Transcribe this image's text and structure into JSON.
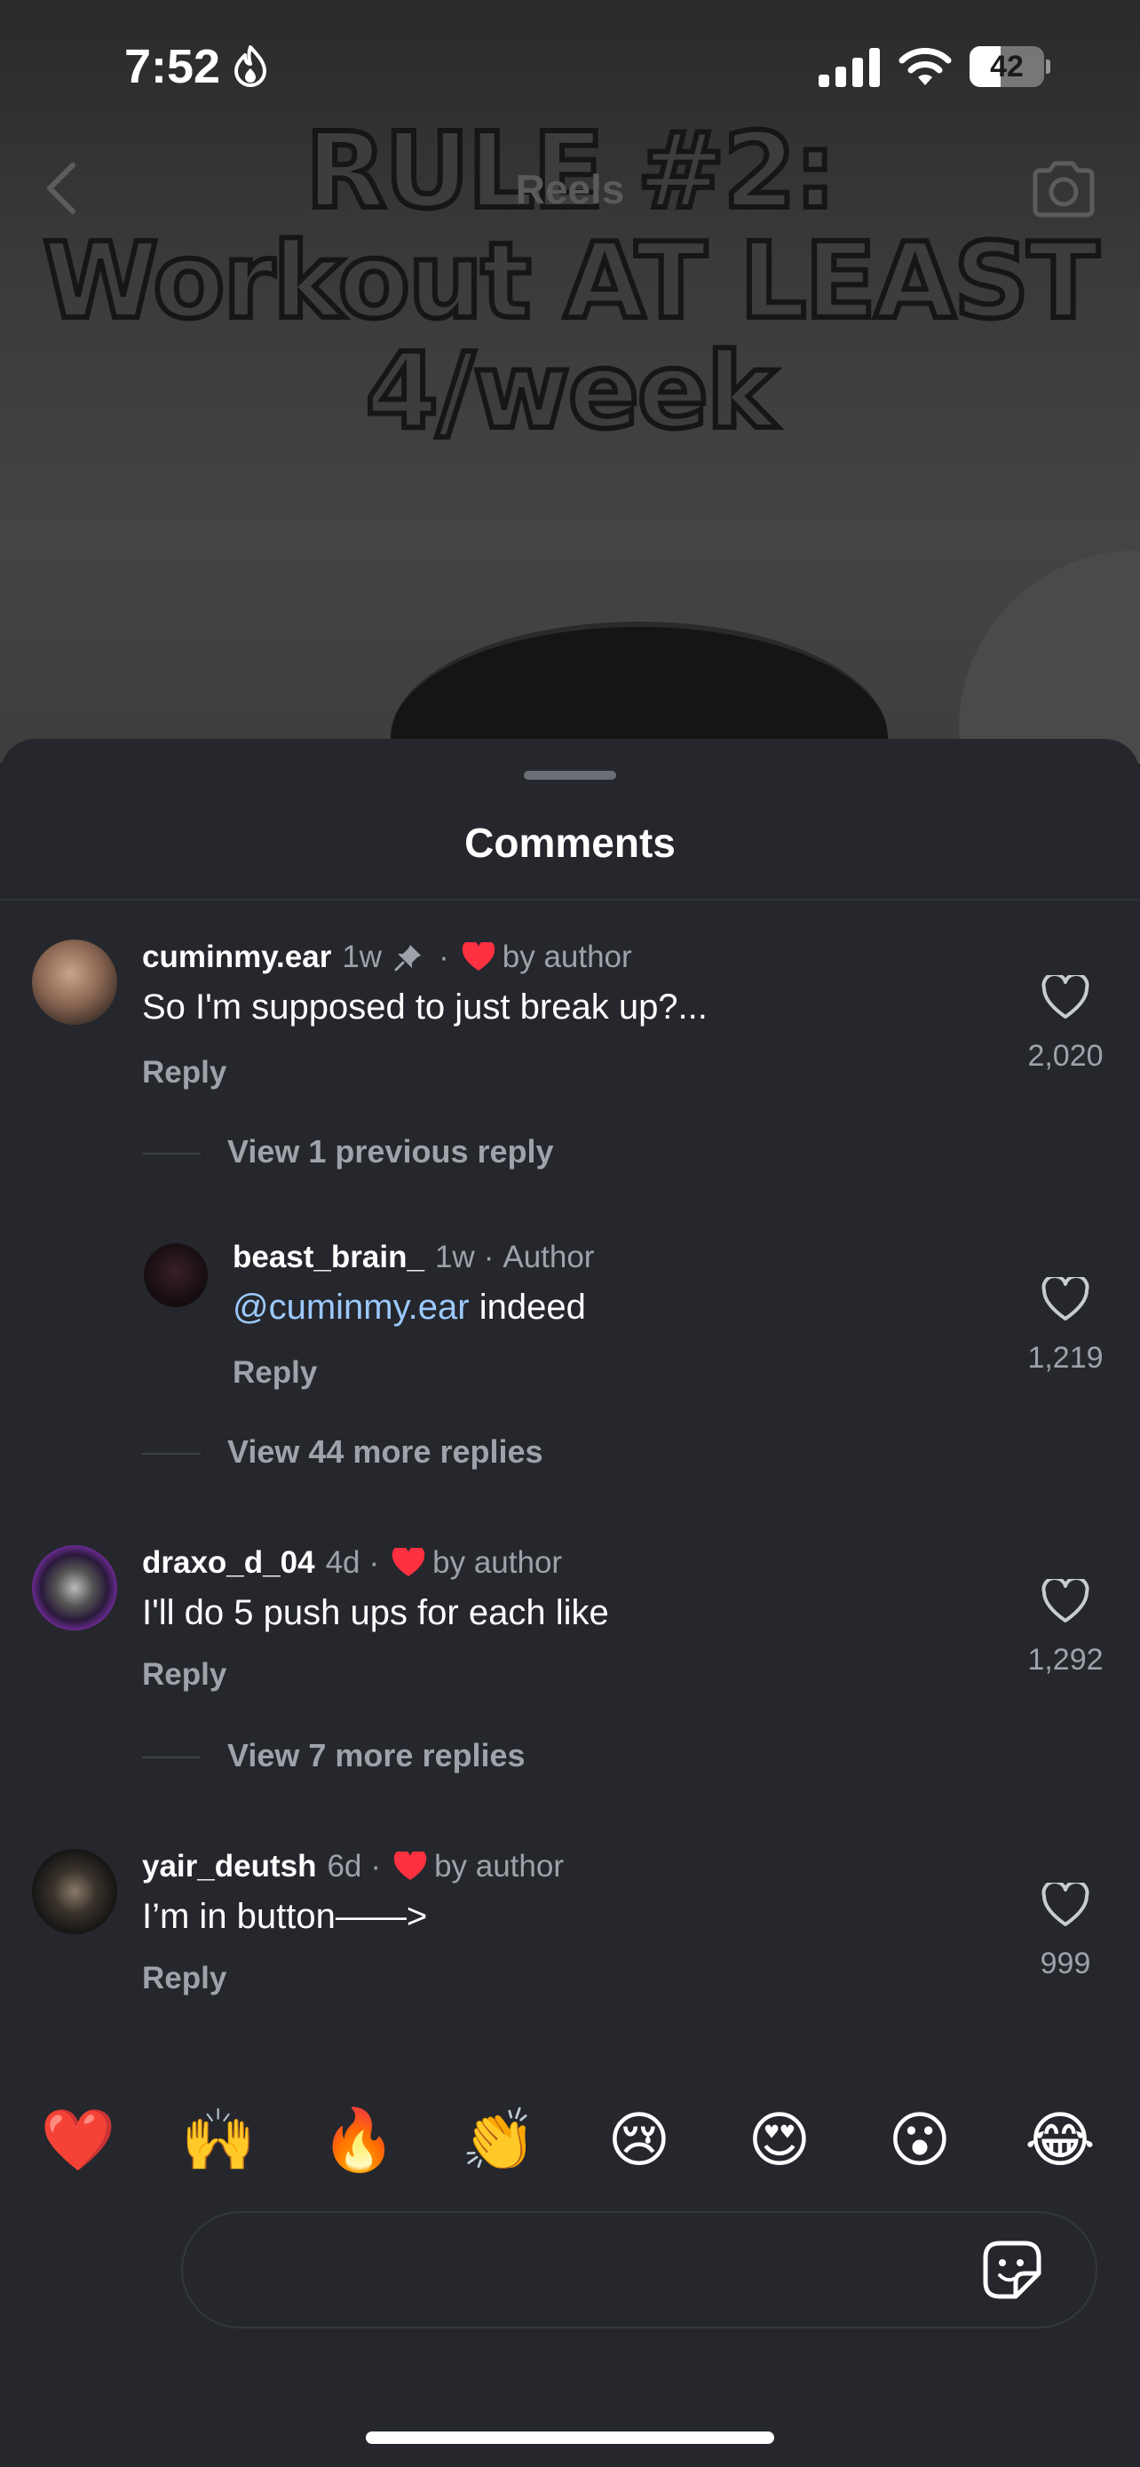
{
  "status_bar": {
    "time": "7:52",
    "battery_level": "42",
    "battery_fraction": 0.42
  },
  "video": {
    "caption_line1": "RULE #2:",
    "caption_line2": "Workout AT LEAST",
    "caption_line3": "4/week"
  },
  "nav": {
    "title": "Reels",
    "back_icon": "chevron-left-icon",
    "camera_icon": "camera-icon"
  },
  "sheet": {
    "title": "Comments"
  },
  "comments": [
    {
      "username": "cuminmy.ear",
      "age": "1w",
      "pinned": true,
      "liked_by": "by author",
      "text": "So I'm supposed to just break up?...",
      "reply_label": "Reply",
      "likes": "2,020"
    },
    {
      "username": "beast_brain_",
      "age": "1w",
      "badge": "Author",
      "mention": "@cuminmy.ear",
      "text": " indeed",
      "reply_label": "Reply",
      "likes": "1,219"
    },
    {
      "username": "draxo_d_04",
      "age": "4d",
      "liked_by": "by author",
      "text": "I'll do 5 push ups for each like",
      "reply_label": "Reply",
      "likes": "1,292"
    },
    {
      "username": "yair_deutsh",
      "age": "6d",
      "liked_by": "by author",
      "text": "I’m in button——>",
      "reply_label": "Reply",
      "likes": "999"
    }
  ],
  "view_replies": [
    "View 1 previous reply",
    "View 44 more replies",
    "View 7 more replies"
  ],
  "emoji_bar": [
    "❤️",
    "🙌",
    "🔥",
    "👏",
    "😢",
    "😍",
    "😮",
    "😂"
  ],
  "input": {
    "placeholder": "",
    "value": ""
  },
  "colors": {
    "sheet_bg": "#25272c",
    "heart_red": "#ff3040",
    "mention_blue": "#9cc9ff",
    "muted_text": "#9ea2a9"
  }
}
